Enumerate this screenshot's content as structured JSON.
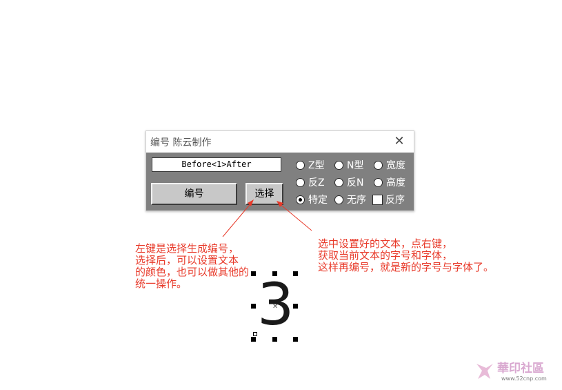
{
  "dialog": {
    "title": "编号   陈云制作",
    "close_symbol": "✕",
    "preview_value": "Before<1>After",
    "number_button": "编号",
    "select_button": "选择",
    "options": [
      {
        "label": "Z型",
        "type": "radio",
        "checked": false
      },
      {
        "label": "N型",
        "type": "radio",
        "checked": false
      },
      {
        "label": "宽度",
        "type": "radio",
        "checked": false
      },
      {
        "label": "反Z",
        "type": "radio",
        "checked": false
      },
      {
        "label": "反N",
        "type": "radio",
        "checked": false
      },
      {
        "label": "高度",
        "type": "radio",
        "checked": false
      },
      {
        "label": "特定",
        "type": "radio",
        "checked": true
      },
      {
        "label": "无序",
        "type": "radio",
        "checked": false
      },
      {
        "label": "反序",
        "type": "checkbox",
        "checked": false
      }
    ]
  },
  "annotations": {
    "left_note": [
      "左键是选择生成编号，",
      "选择后，可以设置文本",
      "的颜色，也可以做其他的",
      "统一操作。"
    ],
    "right_note": [
      "选中设置好的文本，点右键，",
      "获取当前文本的字号和字体，",
      "这样再编号，就是新的字号与字体了。"
    ],
    "note_color": "#e83a2a"
  },
  "canvas_object": {
    "text": "3"
  },
  "watermark": {
    "brand": "華印社區",
    "url": "www.52cnp.com"
  }
}
